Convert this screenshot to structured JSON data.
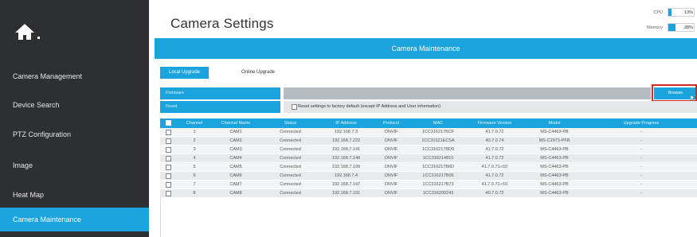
{
  "page": {
    "title": "Camera Settings"
  },
  "sidebar": {
    "items": [
      {
        "label": "Camera Management",
        "active": false
      },
      {
        "label": "Device Search",
        "active": false
      },
      {
        "label": "PTZ Configuration",
        "active": false
      },
      {
        "label": "Image",
        "active": false
      },
      {
        "label": "Heat Map",
        "active": false
      },
      {
        "label": "Camera Maintenance",
        "active": true
      }
    ]
  },
  "meters": {
    "cpu": {
      "label": "CPU",
      "value": "13%",
      "fraction": 0.13
    },
    "memory": {
      "label": "Memory",
      "value": "28%",
      "fraction": 0.28
    }
  },
  "section": {
    "title": "Camera Maintenance"
  },
  "tabs": [
    {
      "label": "Local Upgrade",
      "active": true
    },
    {
      "label": "Online Upgrade",
      "active": false
    }
  ],
  "firmware": {
    "label": "Firmware",
    "browse_label": "Browse"
  },
  "reset": {
    "label": "Reset",
    "option_text": "Reset settings to factory default (except IP Address and User information)"
  },
  "table": {
    "columns": [
      "Channel",
      "Channel Name",
      "Status",
      "IP Address",
      "Protocol",
      "MAC",
      "Firmware Version",
      "Model",
      "Upgrade Progress"
    ],
    "rows": [
      [
        "1",
        "CAM1",
        "Connected",
        "192.168.7.3",
        "ONVIF",
        "1CC316217BCF",
        "41.7.0.72",
        "MS-C4463-PB",
        "-"
      ],
      [
        "2",
        "CAM2",
        "Connected",
        "192.168.7.222",
        "ONVIF",
        "1CC31621ECSA",
        "40.7.0.74",
        "MS-C2973-PFB",
        "-"
      ],
      [
        "3",
        "CAM3",
        "Connected",
        "192.168.7.141",
        "ONVIF",
        "1CC316217BD9",
        "41.7.0.72",
        "MS-C4463-PB",
        "-"
      ],
      [
        "4",
        "CAM4",
        "Connected",
        "192.168.7.148",
        "ONVIF",
        "1CC316214810",
        "41.7.0.72",
        "MS-C4463-PB",
        "-"
      ],
      [
        "5",
        "CAM5",
        "Connected",
        "192.168.7.199",
        "ONVIF",
        "1CC316217B6D",
        "41.7.0.71-r10",
        "MS-C4463-PB",
        "-"
      ],
      [
        "6",
        "CAM6",
        "Connected",
        "192.168.7.4",
        "ONVIF",
        "1CC316217B06",
        "41.7.0.72",
        "MS-C4463-PB",
        "-"
      ],
      [
        "7",
        "CAM7",
        "Connected",
        "192.168.7.147",
        "ONVIF",
        "1CC316217B73",
        "41.7.0.71-r10",
        "MS-C4463-PB",
        "-"
      ],
      [
        "8",
        "CAM8",
        "Connected",
        "192.168.7.191",
        "ONVIF",
        "1CC316200243",
        "40.7.0.72",
        "MS-C4463-PB",
        "-"
      ]
    ]
  },
  "colors": {
    "accent": "#1aa3dc",
    "sidebar": "#2e2f33",
    "highlight": "#d92727"
  }
}
